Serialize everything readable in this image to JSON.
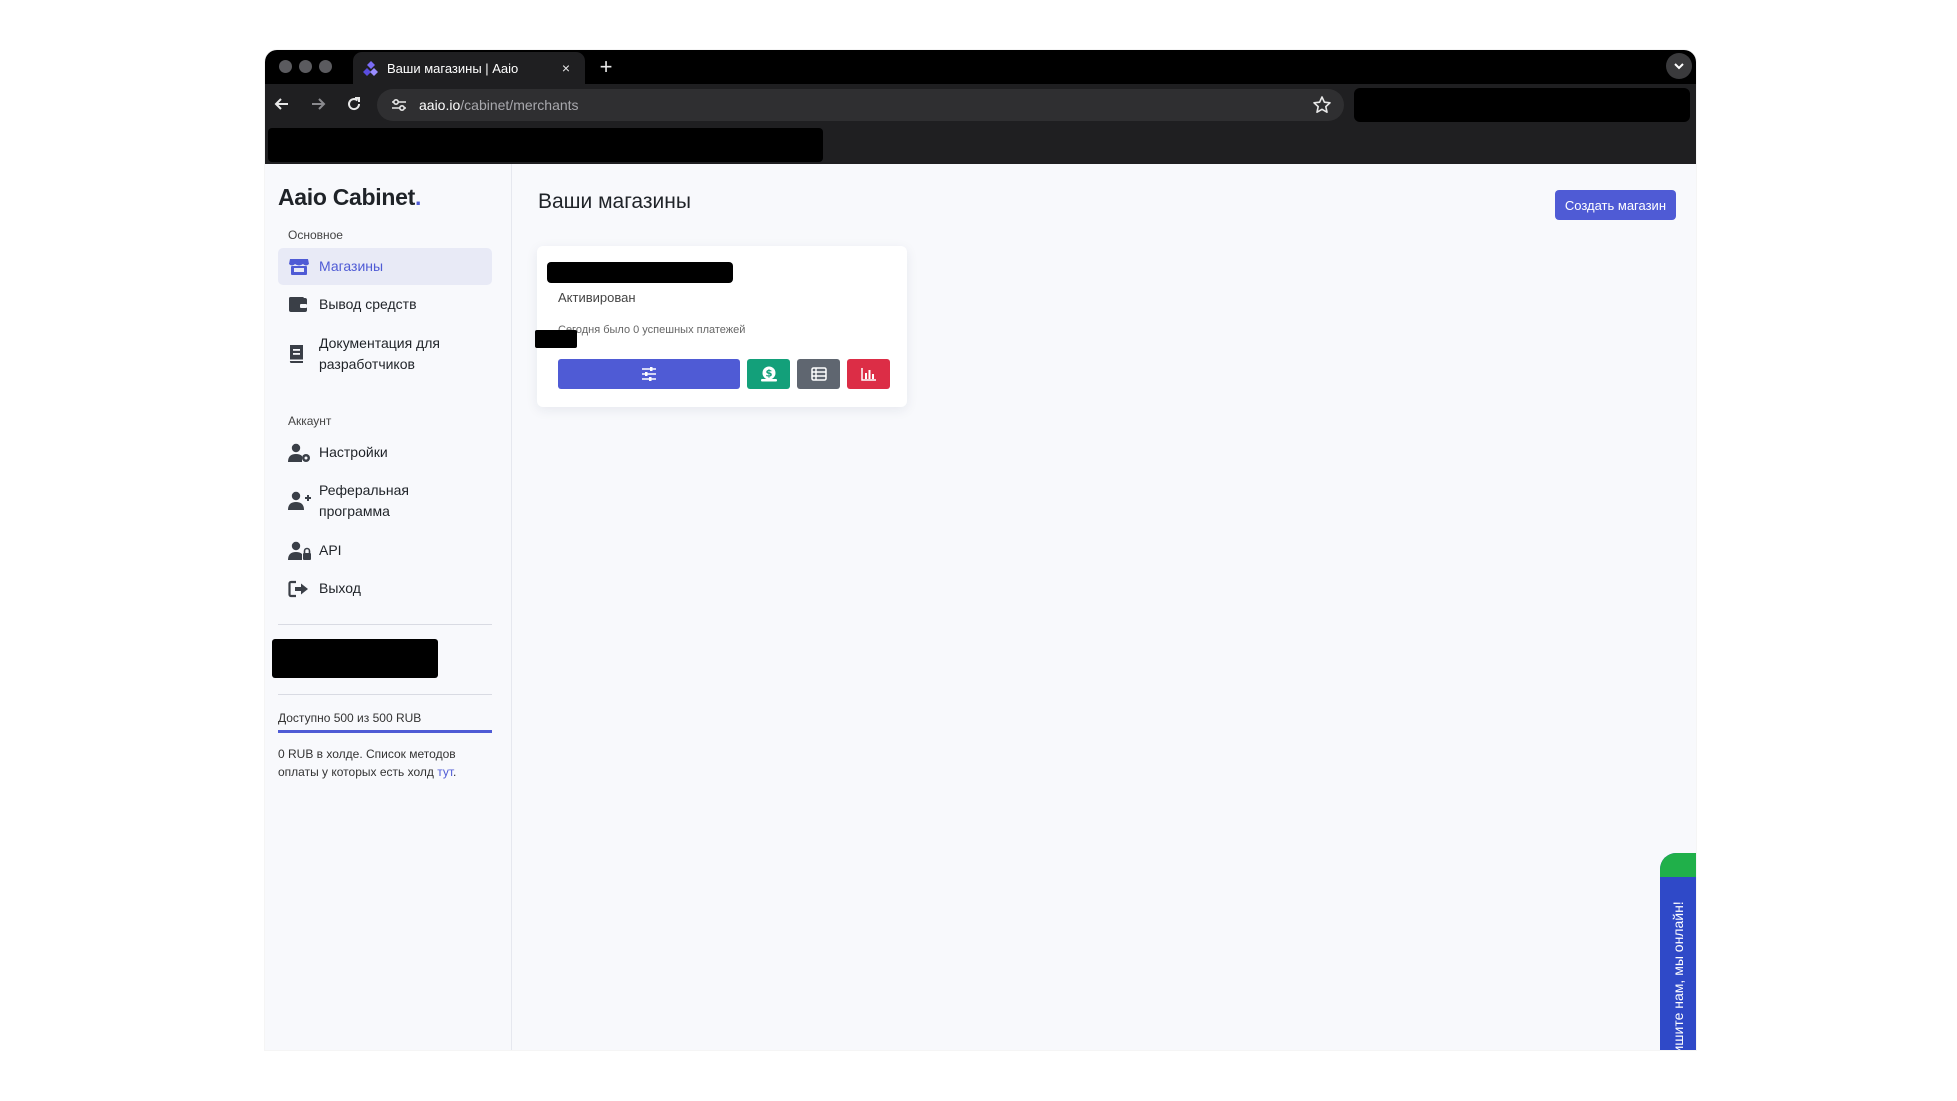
{
  "browser": {
    "tab_title": "Ваши магазины | Aaio",
    "new_tab_symbol": "+",
    "close_symbol": "×",
    "url_host": "aaio.io",
    "url_path": "/cabinet/merchants"
  },
  "sidebar": {
    "brand": "Aaio Cabinet",
    "brand_dot": ".",
    "section_main": "Основное",
    "section_account": "Аккаунт",
    "items": [
      {
        "label": "Магазины",
        "icon": "store-icon",
        "active": true
      },
      {
        "label": "Вывод средств",
        "icon": "wallet-icon"
      },
      {
        "label": "Документация для разработчиков",
        "icon": "book-icon"
      },
      {
        "label": "Настройки",
        "icon": "user-cog-icon"
      },
      {
        "label": "Реферальная программа",
        "icon": "user-plus-icon"
      },
      {
        "label": "API",
        "icon": "user-lock-icon"
      },
      {
        "label": "Выход",
        "icon": "sign-out-icon"
      }
    ],
    "available": "Доступно 500 из 500 RUB",
    "available_fraction": 1.0,
    "hold_text": "0 RUB в холде. Список методов оплаты у которых есть холд ",
    "hold_link": "тут",
    "hold_tail": "."
  },
  "main": {
    "title": "Ваши магазины",
    "create_button": "Создать магазин",
    "card": {
      "status": "Активирован",
      "stat": "Сегодня было 0 успешных платежей"
    }
  },
  "chat": {
    "label": "Напишите нам, мы онлайн!"
  },
  "colors": {
    "accent": "#4f5bd5",
    "success": "#13a07a",
    "secondary": "#5f6670",
    "danger": "#dc2d46",
    "chat": "#2f49c8",
    "chat_accent": "#20b04a"
  }
}
